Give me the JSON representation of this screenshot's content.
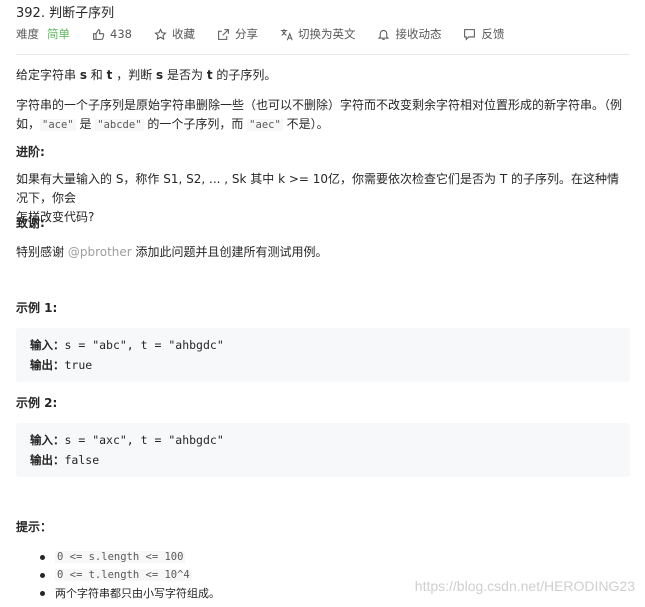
{
  "problem": {
    "title": "392. 判断子序列",
    "difficulty_label": "难度",
    "difficulty": "简单",
    "likes": "438",
    "collect": "收藏",
    "share": "分享",
    "switch_lang": "切换为英文",
    "notify": "接收动态",
    "feedback": "反馈"
  },
  "desc": {
    "p1_a": "给定字符串 ",
    "p1_s": "s",
    "p1_b": " 和 ",
    "p1_t": "t",
    "p1_c": " ，判断 ",
    "p1_s2": "s",
    "p1_d": " 是否为 ",
    "p1_t2": "t",
    "p1_e": " 的子序列。",
    "p2_line1": "字符串的一个子序列是原始字符串删除一些（也可以不删除）字符而不改变剩余字符相对位置形成的新字符串。（例",
    "p2_a": "如，",
    "p2_code1": "\"ace\"",
    "p2_b": " 是 ",
    "p2_code2": "\"abcde\"",
    "p2_c": " 的一个子序列，而 ",
    "p2_code3": "\"aec\"",
    "p2_d": " 不是）。",
    "advanced_title": "进阶:",
    "advanced_line1": "如果有大量输入的 S，称作 S1, S2, ... , Sk 其中 k >= 10亿，你需要依次检查它们是否为 T 的子序列。在这种情况下，你会",
    "advanced_line2": "怎样改变代码?",
    "thanks_title": "致谢:",
    "thanks_a": "特别感谢 ",
    "thanks_user": "@pbrother",
    "thanks_b": " 添加此问题并且创建所有测试用例。"
  },
  "examples": [
    {
      "title": "示例 1:",
      "input_label": "输入：",
      "input": "s = \"abc\", t = \"ahbgdc\"",
      "output_label": "输出：",
      "output": "true"
    },
    {
      "title": "示例 2:",
      "input_label": "输入：",
      "input": "s = \"axc\", t = \"ahbgdc\"",
      "output_label": "输出：",
      "output": "false"
    }
  ],
  "hints": {
    "title": "提示：",
    "items": [
      "0 <= s.length <= 100",
      "0 <= t.length <= 10^4",
      "两个字符串都只由小写字符组成。"
    ]
  },
  "watermark": "https://blog.csdn.net/HERODING23",
  "colors": {
    "difficulty_easy": "#5cb85c",
    "code_bg": "#f7f8fa"
  }
}
